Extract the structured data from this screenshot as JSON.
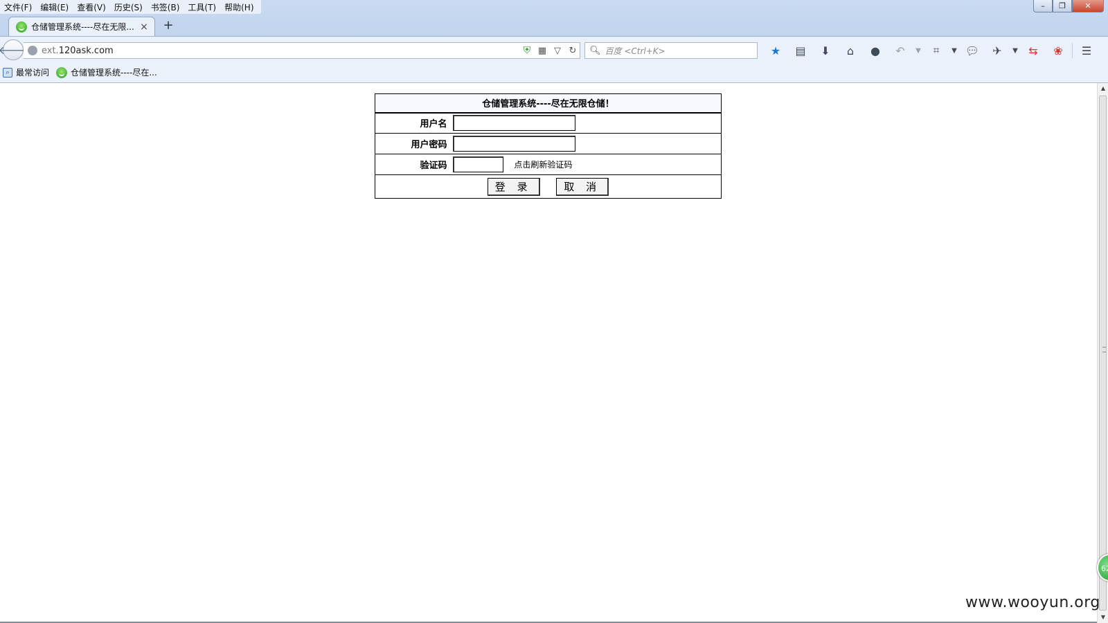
{
  "menubar": {
    "items": [
      "文件(F)",
      "编辑(E)",
      "查看(V)",
      "历史(S)",
      "书签(B)",
      "工具(T)",
      "帮助(H)"
    ]
  },
  "window_controls": {
    "minimize": "–",
    "restore": "❐",
    "close": "✕"
  },
  "tab": {
    "title": "仓储管理系统----尽在无限...",
    "close": "×",
    "new_tab": "+"
  },
  "navbar": {
    "url_prefix": "ext.",
    "url_main": "120ask.com",
    "search_placeholder": "百度 <Ctrl+K>"
  },
  "bookmarks": {
    "items": [
      "最常访问",
      "仓储管理系统----尽在..."
    ]
  },
  "login_form": {
    "title": "仓储管理系统----尽在无限仓储！",
    "username_label": "用户名",
    "username_value": "",
    "password_label": "用户密码",
    "password_value": "",
    "captcha_label": "验证码",
    "captcha_value": "",
    "captcha_refresh_text": "点击刷新验证码",
    "login_button": "登 录",
    "cancel_button": "取 消"
  },
  "float_badge": "62",
  "watermark": "www.wooyun.org",
  "colors": {
    "chrome_bg": "#c9daf1",
    "toolbar_bg": "#eaf1fb",
    "favicon_green": "#23a128",
    "bookmark_star": "#1c78d4",
    "close_red": "#c8452f"
  }
}
